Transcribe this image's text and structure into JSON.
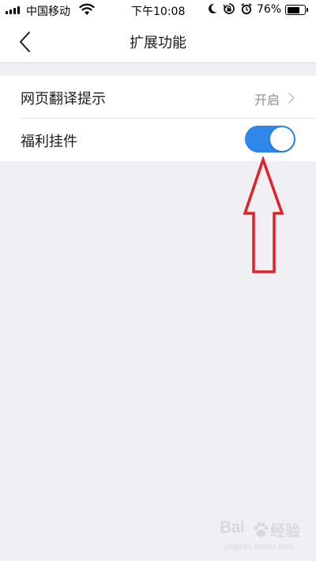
{
  "status_bar": {
    "carrier": "中国移动",
    "time": "下午10:08",
    "battery_percent": "76%",
    "battery_level": 0.76,
    "signal_bars": 4
  },
  "nav": {
    "title": "扩展功能"
  },
  "settings": {
    "rows": [
      {
        "label": "网页翻译提示",
        "value": "开启"
      },
      {
        "label": "福利挂件",
        "toggle_on": true
      }
    ]
  },
  "annotation": {
    "arrow_color": "#e0212a"
  },
  "watermark": {
    "brand": "Bai",
    "brand_suffix": "经验",
    "url": "jingyan.baidu.com"
  },
  "colors": {
    "toggle_on": "#2f86eb",
    "background": "#efeff4",
    "secondary_text": "#8e8e93"
  }
}
